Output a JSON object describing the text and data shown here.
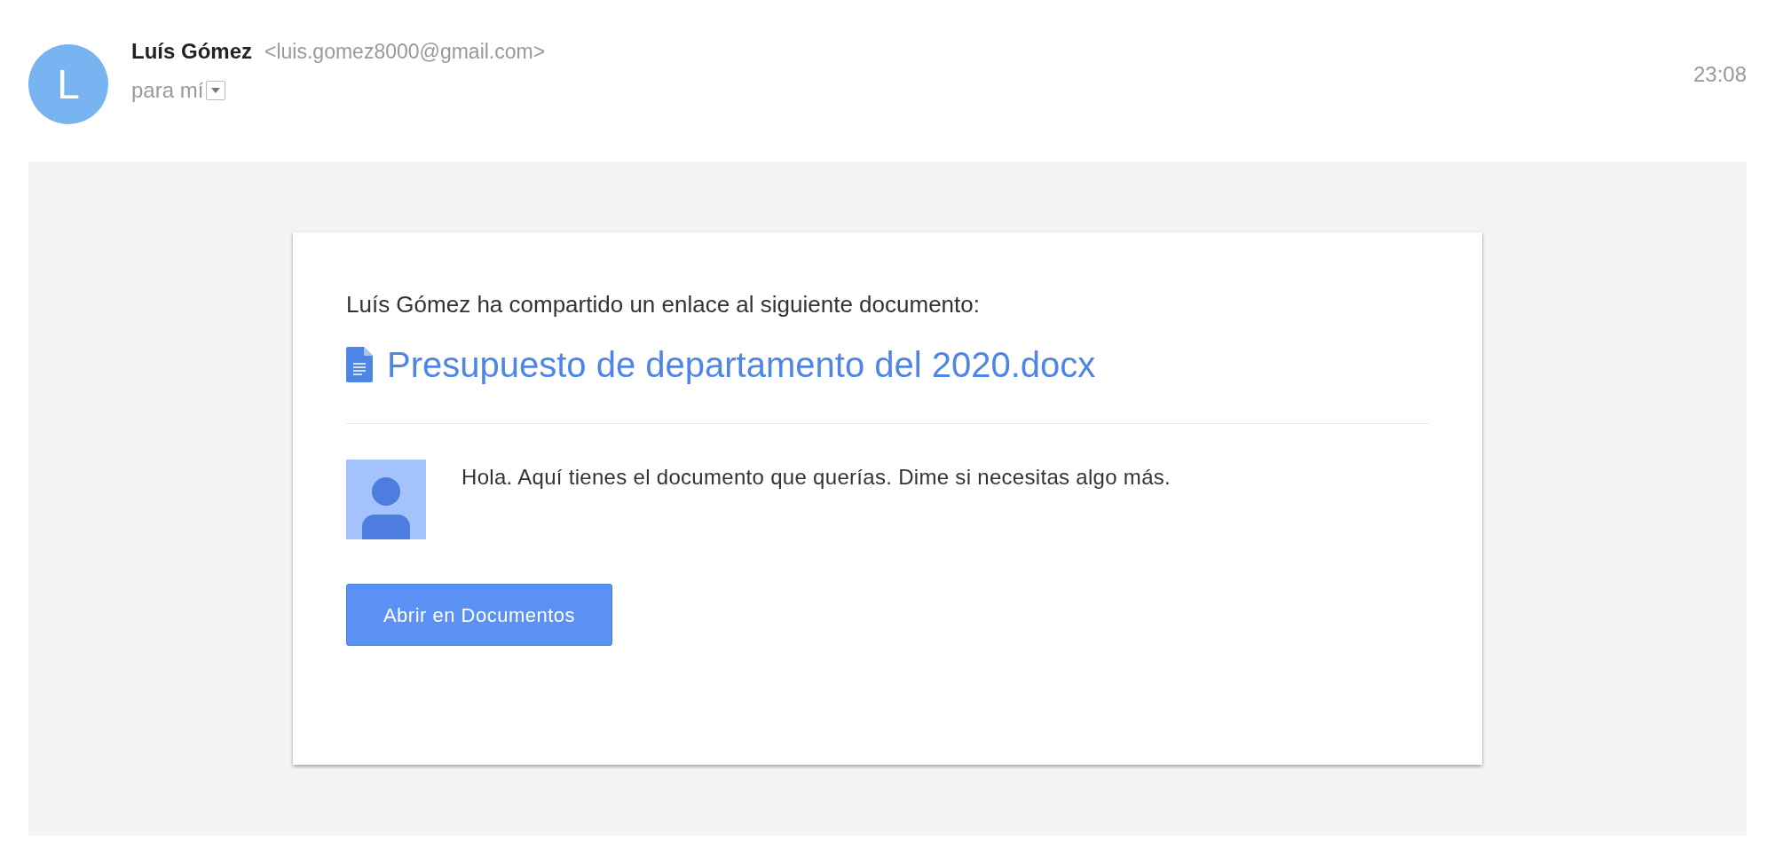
{
  "sender": {
    "initial": "L",
    "name": "Luís Gómez",
    "email": "<luis.gomez8000@gmail.com>",
    "recipient": "para mí",
    "time": "23:08"
  },
  "card": {
    "intro": "Luís Gómez ha compartido un enlace al siguiente documento:",
    "document": "Presupuesto de departamento del 2020.docx",
    "message": "Hola. Aquí tienes el documento que querías. Dime si necesitas algo más.",
    "button": "Abrir en Documentos"
  }
}
